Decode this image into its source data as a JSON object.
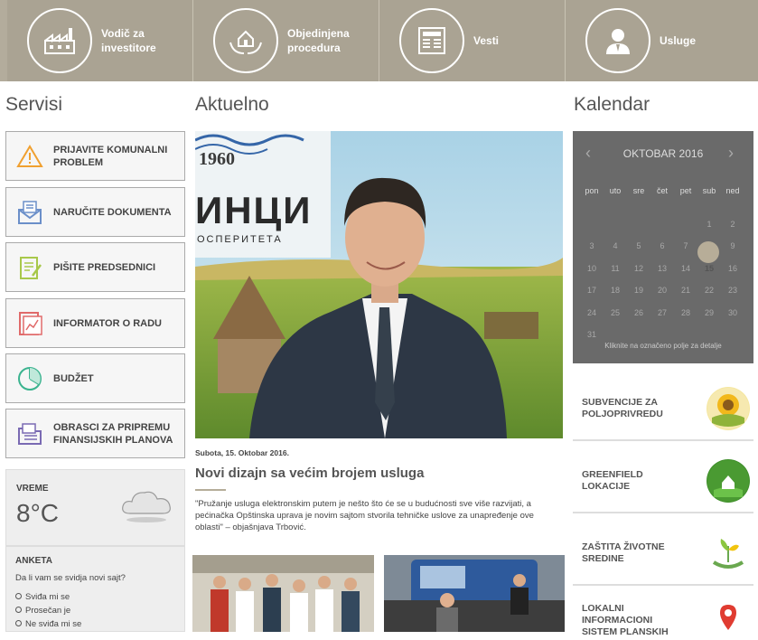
{
  "nav": {
    "items": [
      {
        "label": "Vodič za investitore",
        "icon": "factory-icon"
      },
      {
        "label": "Objedinjena procedura",
        "icon": "house-hands-icon"
      },
      {
        "label": "Vesti",
        "icon": "newspaper-icon"
      },
      {
        "label": "Usluge",
        "icon": "person-icon"
      }
    ]
  },
  "servisi": {
    "title": "Servisi",
    "items": [
      {
        "label": "PRIJAVITE KOMUNALNI PROBLEM",
        "icon": "warning-icon"
      },
      {
        "label": "NARUČITE DOKUMENTA",
        "icon": "mail-document-icon"
      },
      {
        "label": "PIŠITE PREDSEDNICI",
        "icon": "write-icon"
      },
      {
        "label": "INFORMATOR O RADU",
        "icon": "report-chart-icon"
      },
      {
        "label": "BUDŽET",
        "icon": "pie-chart-icon"
      },
      {
        "label": "OBRASCI ZA PRIPREMU FINANSIJSKIH PLANOVA",
        "icon": "folder-forms-icon"
      }
    ]
  },
  "weather": {
    "label": "VREME",
    "temp": "8°C",
    "icon": "cloud-icon"
  },
  "poll": {
    "title": "ANKETA",
    "question": "Da li vam se svidja novi sajt?",
    "options": [
      "Sviđa mi se",
      "Prosečan je",
      "Ne sviđa mi se"
    ]
  },
  "aktuelno": {
    "title": "Aktuelno",
    "photo_text_year": "1960",
    "photo_text_main": "ИНЦИ",
    "photo_text_sub": "ОСПЕРИТЕТА",
    "date": "Subota, 15. Oktobar 2016.",
    "headline": "Novi dizajn sa većim brojem usluga",
    "excerpt": "\"Pružanje usluga elektronskim putem je nešto što će se u budućnosti sve više razvijati, a pećinačka Opštinska uprava je novim sajtom stvorila tehničke uslove za unapređenje ove oblasti\" – objašnjava Trbović."
  },
  "calendar": {
    "title": "Kalendar",
    "month": "OKTOBAR 2016",
    "weekdays": [
      "pon",
      "uto",
      "sre",
      "čet",
      "pet",
      "sub",
      "ned"
    ],
    "weeks": [
      [
        "",
        "",
        "",
        "",
        "",
        "1",
        "2"
      ],
      [
        "3",
        "4",
        "5",
        "6",
        "7",
        "8",
        "9"
      ],
      [
        "10",
        "11",
        "12",
        "13",
        "14",
        "15",
        "16"
      ],
      [
        "17",
        "18",
        "19",
        "20",
        "21",
        "22",
        "23"
      ],
      [
        "24",
        "25",
        "26",
        "27",
        "28",
        "29",
        "30"
      ],
      [
        "31",
        "",
        "",
        "",
        "",
        "",
        ""
      ]
    ],
    "today": "15",
    "hint": "Kliknite na označeno polje za detalje"
  },
  "promos": [
    {
      "label": "SUBVENCIJE ZA POLJOPRIVREDU",
      "icon": "sunflower-icon"
    },
    {
      "label": "GREENFIELD LOKACIJE",
      "icon": "green-house-icon"
    },
    {
      "label": "ZAŠTITA ŽIVOTNE SREDINE",
      "icon": "plant-icon"
    },
    {
      "label": "LOKALNI INFORMACIONI SISTEM PLANSKIH",
      "icon": "map-pin-icon"
    }
  ],
  "colors": {
    "nav_bg": "#aaa393",
    "calendar_bg": "#6a6a6a",
    "today_bg": "#b7ad98"
  }
}
